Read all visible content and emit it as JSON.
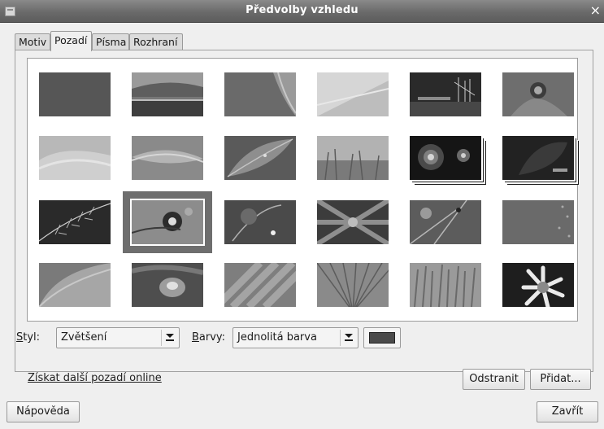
{
  "window": {
    "title": "Předvolby vzhledu",
    "close_glyph": "×"
  },
  "tabs": [
    {
      "label": "Motiv",
      "active": false
    },
    {
      "label": "Pozadí",
      "active": true
    },
    {
      "label": "Písma",
      "active": false
    },
    {
      "label": "Rozhraní",
      "active": false
    }
  ],
  "gallery": {
    "selected_index": 13,
    "items": [
      {
        "name": "solid-dark-gray",
        "theme": "plain"
      },
      {
        "name": "sea-horizon",
        "theme": "sea"
      },
      {
        "name": "gray-curve",
        "theme": "curve"
      },
      {
        "name": "light-sand",
        "theme": "light"
      },
      {
        "name": "ship-masts",
        "theme": "masts"
      },
      {
        "name": "flower-bloom",
        "theme": "bloom"
      },
      {
        "name": "light-waves",
        "theme": "lightwaves"
      },
      {
        "name": "gray-wave",
        "theme": "wave"
      },
      {
        "name": "green-leaf",
        "theme": "leaf"
      },
      {
        "name": "grass-field",
        "theme": "grass"
      },
      {
        "name": "spiral-galaxy",
        "theme": "galaxy",
        "slideshow": true
      },
      {
        "name": "dark-slideshow",
        "theme": "darkleaf",
        "slideshow": true
      },
      {
        "name": "fern",
        "theme": "fern"
      },
      {
        "name": "flower-branch",
        "theme": "branch"
      },
      {
        "name": "dew-flower",
        "theme": "dew"
      },
      {
        "name": "palm-leaves",
        "theme": "palm"
      },
      {
        "name": "ladybug-grass",
        "theme": "ladybug"
      },
      {
        "name": "dotted-gray",
        "theme": "dots"
      },
      {
        "name": "soft-curve",
        "theme": "softcurve"
      },
      {
        "name": "water-drop",
        "theme": "drop"
      },
      {
        "name": "diagonal-stripes",
        "theme": "diagonal"
      },
      {
        "name": "fan-lines",
        "theme": "fan"
      },
      {
        "name": "spiky-plants",
        "theme": "spikes"
      },
      {
        "name": "daisy",
        "theme": "daisy"
      }
    ]
  },
  "options": {
    "style_label": "Styl:",
    "style_value": "Zvětšení",
    "colors_label": "Barvy:",
    "colors_value": "Jednolitá barva",
    "color_swatch": "#4a4a4a"
  },
  "links": {
    "more_online": "Získat další pozadí online"
  },
  "buttons": {
    "remove": "Odstranit",
    "add": "Přidat...",
    "help": "Nápověda",
    "close": "Zavřít"
  }
}
